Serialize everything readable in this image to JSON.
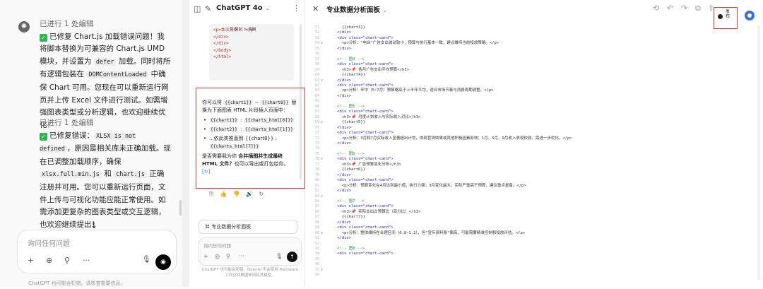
{
  "chat": {
    "messages": [
      {
        "status": "已进行 1 处编辑",
        "body_before": "已修复 Chart.js 加载错误问题！我将脚本替换为可兼容的 Chart.js UMD 模块，并设置为 ",
        "code1": "defer",
        "body_middle": " 加载。同时将所有逻辑包装在 ",
        "code2": "DOMContentLoaded",
        "body_after": " 中确保 Chart 可用。您现在可以重新运行网页并上传 Excel 文件进行测试。如需增强图表类型或分析逻辑，也欢迎继续优化！"
      },
      {
        "status": "已进行 1 处编辑",
        "body_before": "已修复错误：",
        "code1": "XLSX is not defined",
        "body_middle": "，原因是相关库未正确加载。现在已调整加载顺序，确保 ",
        "code2": "xlsx.full.min.js",
        "body_mid2": " 和 ",
        "code3": "chart.js",
        "body_after": " 正确注册并可用。您可以重新运行页面，文件上传与可视化功能应能正常使用。如需添加更复杂的图表类型或交互逻辑，也欢迎继续提出！"
      }
    ],
    "composer": {
      "placeholder": "询问任何问题",
      "plus": "+",
      "globe": "⊕",
      "tools": "⚲",
      "more": "···",
      "mic": "🎙",
      "voice": "◉"
    },
    "footer": "ChatGPT 也可能会犯错。请核查重要信息。"
  },
  "middle": {
    "title": "ChatGPT 4o",
    "chevron": "⌄",
    "code_lines": [
      "<p>本次分析...</p>",
      "</div>",
      "</div>",
      "",
      "</body>",
      "</html>"
    ],
    "code_popup": "⎘ 复制   ✎ 编辑",
    "response": {
      "intro_before": "你可以将 ",
      "intro_code1": "{{chart1}}",
      "intro_mid": " ~ ",
      "intro_code2": "{{chart8}}",
      "intro_after": " 替换为下面图表 HTML 片段插入页面中：",
      "bullets": [
        {
          "a": "{{chart1}}",
          "b": "{{charts_html[0]}}"
        },
        {
          "a": "{{chart2}}",
          "b": "{{charts_html[1]}}"
        },
        {
          "a": "...依此类推直到 {{chart8}}",
          "b": "{{charts_html[7]}}"
        }
      ],
      "question_before": "是否需要我为你 ",
      "question_bold": "合并插图并生成最终 HTML 文件？",
      "question_after": "也可以导出或打包给你。",
      "ref": "[↻]"
    },
    "actions": "⎘ 👍 👎 🔊 ↻",
    "canvas_pill": "⌘ 专业数据分析面板",
    "composer_placeholder": "询问任何问题",
    "footer": "ChatGPT 也可能会犯错。OpenAI 不会使用 Hardware 工作空间数据来训练其模型。"
  },
  "canvas": {
    "title": "专业数据分析面板",
    "chevron": "⌄",
    "publish_label": "发布",
    "line_numbers": [
      51,
      52,
      53,
      54,
      55,
      56,
      57,
      58,
      59,
      60,
      61,
      62,
      63,
      64,
      65,
      66,
      67,
      68,
      69,
      70,
      71,
      72,
      73,
      74,
      75,
      76,
      77,
      78,
      79,
      80,
      81,
      82,
      83,
      84,
      85,
      86,
      87,
      88,
      89,
      90,
      91,
      92,
      93,
      94,
      95,
      96,
      97,
      98
    ],
    "folds": [
      "",
      "",
      "",
      "∨",
      "",
      "",
      "",
      "",
      "",
      "",
      "∨",
      "",
      "",
      "",
      "",
      "",
      "",
      "",
      "∨",
      "",
      "",
      "",
      "",
      "",
      "",
      "∨",
      "",
      "",
      "",
      "",
      "",
      "",
      "∨",
      "",
      "",
      "",
      "",
      "",
      "",
      "∨",
      "",
      "",
      "",
      "",
      "",
      "",
      "∨",
      "",
      "",
      ""
    ],
    "code": [
      {
        "t": "      {{chart3}}",
        "k": "tx"
      },
      {
        "t": "    </div>",
        "k": ""
      },
      {
        "t": "    <div class=\"chart-card\">",
        "k": ""
      },
      {
        "t": "      <p>分析：\"电台\"广告支出波动较小，预算与执行基本一致，建议维持当前投放策略。</p>",
        "k": "tx"
      },
      {
        "t": "    </div>",
        "k": ""
      },
      {
        "t": "",
        "k": ""
      },
      {
        "t": "    <!-- 图4 -->",
        "k": "cm"
      },
      {
        "t": "    <div class=\"chart-card\">",
        "k": ""
      },
      {
        "t": "      <h3>📌 各月广告支出平均预算</h3>",
        "k": "tx"
      },
      {
        "t": "      {{chart4}}",
        "k": "tx"
      },
      {
        "t": "    </div>",
        "k": ""
      },
      {
        "t": "    <div class=\"chart-card\">",
        "k": ""
      },
      {
        "t": "      <p>分析：年中（5~7月）预算略高于上半年平均，适合市场节奏与消费周期调整。</p>",
        "k": "tx"
      },
      {
        "t": "    </div>",
        "k": ""
      },
      {
        "t": "",
        "k": ""
      },
      {
        "t": "    <!-- 图5 -->",
        "k": "cm"
      },
      {
        "t": "    <div class=\"chart-card\">",
        "k": ""
      },
      {
        "t": "      <h3>📌 月度计划收入与实际收入对比</h3>",
        "k": "tx"
      },
      {
        "t": "      {{chart5}}",
        "k": "tx"
      },
      {
        "t": "    </div>",
        "k": ""
      },
      {
        "t": "    <div class=\"chart-card\">",
        "k": ""
      },
      {
        "t": "      <p>分析：3月和7月实际收入显著超出计划，体现营销效果或其他积极因素影响；1月、5月、9月收入表现较弱，需进一步优化。</p>",
        "k": "tx"
      },
      {
        "t": "    </div>",
        "k": ""
      },
      {
        "t": "",
        "k": ""
      },
      {
        "t": "    <!-- 图6 -->",
        "k": "cm"
      },
      {
        "t": "    <div class=\"chart-card\">",
        "k": ""
      },
      {
        "t": "      <h3>📌 广告预算变化分析</h3>",
        "k": "tx"
      },
      {
        "t": "      {{chart6}}",
        "k": "tx"
      },
      {
        "t": "    </div>",
        "k": ""
      },
      {
        "t": "    <div class=\"chart-card\">",
        "k": ""
      },
      {
        "t": "      <p>分析：预算变化在4月达到最小值，执行力强；3月变化最大，实际严重高于预算，建议重点复盘。</p>",
        "k": "tx"
      },
      {
        "t": "    </div>",
        "k": ""
      },
      {
        "t": "",
        "k": ""
      },
      {
        "t": "    <!-- 图7 -->",
        "k": "cm"
      },
      {
        "t": "    <div class=\"chart-card\">",
        "k": ""
      },
      {
        "t": "      <h3>📌 实际支出占预算比（百分比）</h3>",
        "k": "tx"
      },
      {
        "t": "      {{chart7}}",
        "k": "tx"
      },
      {
        "t": "    </div>",
        "k": ""
      },
      {
        "t": "    <div class=\"chart-card\">",
        "k": ""
      },
      {
        "t": "      <p>分析：整体维持在合理区间（0.8~1.1），但\"宣传资料费\"偏高，可能需要精准控制和投放评估。</p>",
        "k": "tx"
      },
      {
        "t": "    </div>",
        "k": ""
      },
      {
        "t": "",
        "k": ""
      },
      {
        "t": "    <!-- 图8 -->",
        "k": "cm"
      },
      {
        "t": "    <div class=\"chart-card\">",
        "k": ""
      },
      {
        "t": "",
        "k": ""
      },
      {
        "t": "",
        "k": ""
      },
      {
        "t": "",
        "k": ""
      },
      {
        "t": "",
        "k": ""
      }
    ]
  },
  "colors": {
    "highlight": "#e53935",
    "check": "#2db84d",
    "accent": "#3a6ee8"
  }
}
